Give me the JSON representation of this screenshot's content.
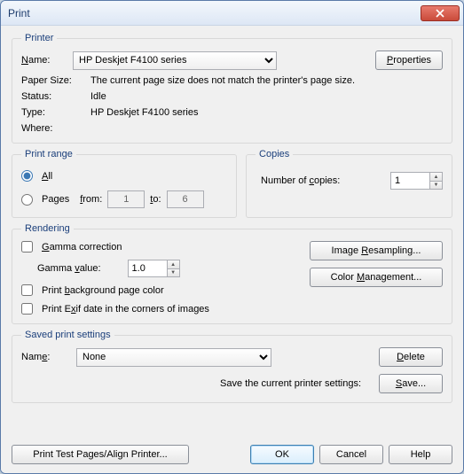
{
  "window": {
    "title": "Print"
  },
  "printer": {
    "legend": "Printer",
    "name_label": "Name:",
    "name_value": "HP Deskjet F4100 series",
    "properties_btn": "Properties",
    "paper_size_label": "Paper Size:",
    "paper_size_value": "The current page size does not match the printer's page size.",
    "status_label": "Status:",
    "status_value": "Idle",
    "type_label": "Type:",
    "type_value": "HP Deskjet F4100 series",
    "where_label": "Where:",
    "where_value": ""
  },
  "range": {
    "legend": "Print range",
    "all": "All",
    "pages": "Pages",
    "from_label": "from:",
    "from_value": "1",
    "to_label": "to:",
    "to_value": "6"
  },
  "copies": {
    "legend": "Copies",
    "num_label": "Number of copies:",
    "num_value": "1"
  },
  "rendering": {
    "legend": "Rendering",
    "gamma_correction": "Gamma correction",
    "gamma_value_label": "Gamma value:",
    "gamma_value": "1.0",
    "print_bg": "Print background page color",
    "print_exif": "Print Exif date in the corners of images",
    "img_resample": "Image Resampling...",
    "color_mgmt": "Color Management..."
  },
  "saved": {
    "legend": "Saved print settings",
    "name_label": "Name:",
    "name_value": "None",
    "save_hint": "Save the current printer settings:",
    "delete_btn": "Delete",
    "save_btn": "Save..."
  },
  "footer": {
    "test": "Print Test Pages/Align Printer...",
    "ok": "OK",
    "cancel": "Cancel",
    "help": "Help"
  }
}
